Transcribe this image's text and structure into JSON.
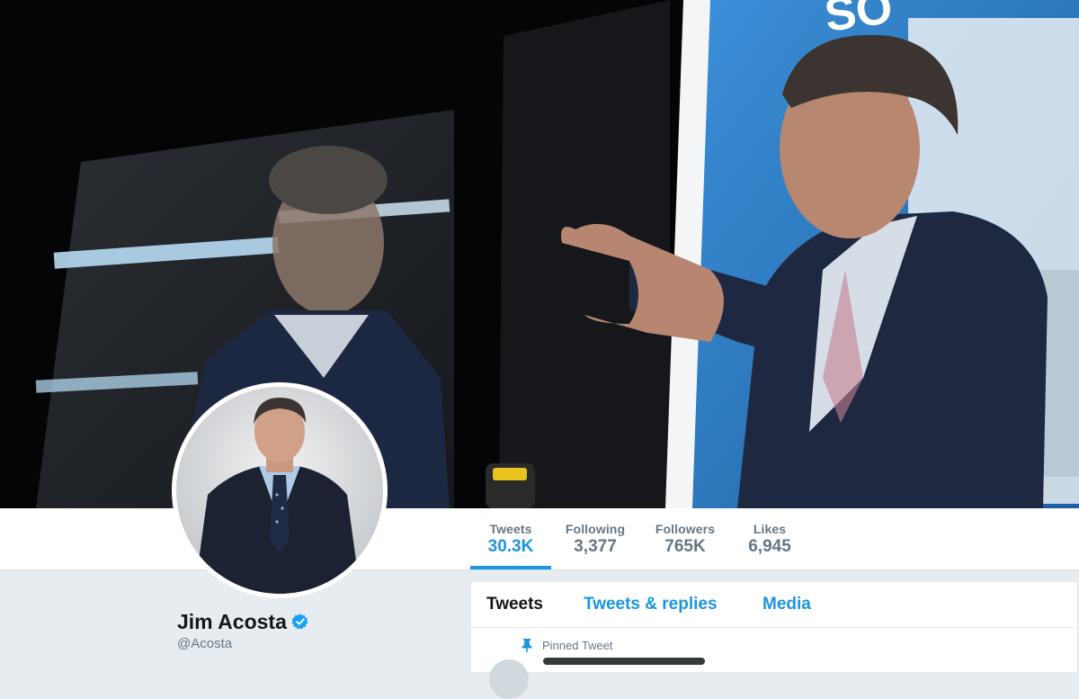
{
  "banner": {
    "alt": "Header photo",
    "screen_text": "SO"
  },
  "stats": [
    {
      "label": "Tweets",
      "value": "30.3K"
    },
    {
      "label": "Following",
      "value": "3,377"
    },
    {
      "label": "Followers",
      "value": "765K"
    },
    {
      "label": "Likes",
      "value": "6,945"
    }
  ],
  "profile": {
    "name": "Jim Acosta",
    "handle": "@Acosta",
    "verified": true
  },
  "timeline": {
    "tabs": [
      "Tweets",
      "Tweets & replies",
      "Media"
    ],
    "active_tab": "Tweets",
    "pinned_label": "Pinned Tweet"
  },
  "colors": {
    "accent": "#1b95e0",
    "muted": "#657786",
    "background": "#e6ecf0",
    "verified": "#1da1f2"
  }
}
